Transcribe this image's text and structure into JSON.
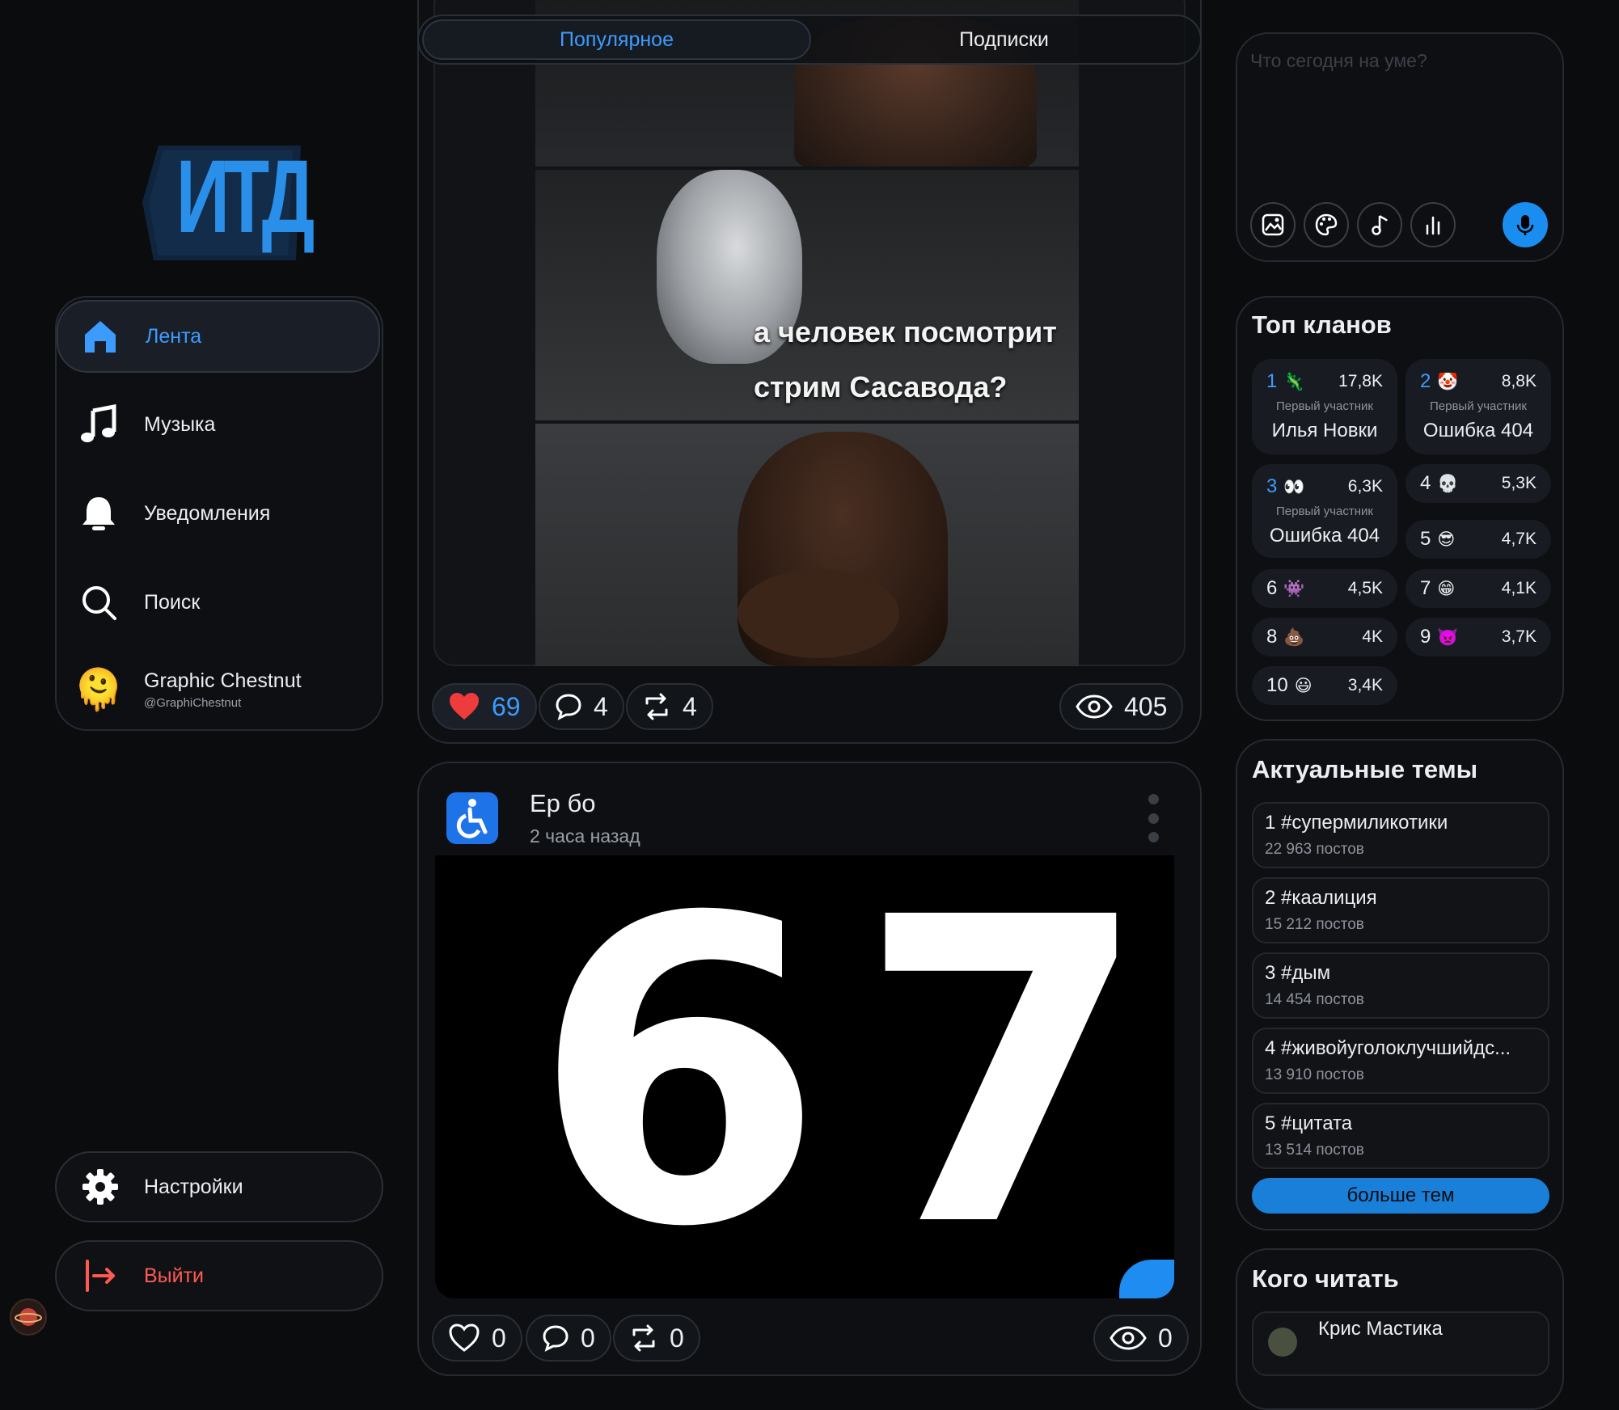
{
  "app": {
    "logo_text": "ИТД"
  },
  "nav": {
    "items": [
      {
        "label": "Лента",
        "icon": "home-icon",
        "active": true
      },
      {
        "label": "Музыка",
        "icon": "music-note-icon"
      },
      {
        "label": "Уведомления",
        "icon": "bell-icon"
      },
      {
        "label": "Поиск",
        "icon": "search-icon"
      }
    ],
    "profile": {
      "name": "Graphic Chestnut",
      "handle": "@GraphiChestnut",
      "avatar_emoji": "🫠"
    },
    "settings_label": "Настройки",
    "logout_label": "Выйти"
  },
  "feed": {
    "tabs": [
      {
        "label": "Популярное",
        "active": true
      },
      {
        "label": "Подписки"
      }
    ],
    "post1": {
      "meme_text_line1": "а человек посмотрит",
      "meme_text_line2": "стрим Сасавода?",
      "likes": "69",
      "comments": "4",
      "reposts": "4",
      "views": "405"
    },
    "post2": {
      "author": "Ер бо",
      "avatar_emoji": "♿",
      "time": "2 часа назад",
      "image_text": "67",
      "likes": "0",
      "comments": "0",
      "reposts": "0",
      "views": "0"
    }
  },
  "composer": {
    "placeholder": "Что сегодня на уме?"
  },
  "clans": {
    "title": "Топ кланов",
    "first_member_label": "Первый участник",
    "items": [
      {
        "rank": "1",
        "emoji": "🦎",
        "count": "17,8K",
        "member": "Илья Новки"
      },
      {
        "rank": "2",
        "emoji": "🤡",
        "count": "8,8K",
        "member": "Ошибка 404"
      },
      {
        "rank": "3",
        "emoji": "👀",
        "count": "6,3K",
        "member": "Ошибка 404"
      },
      {
        "rank": "4",
        "emoji": "💀",
        "count": "5,3K"
      },
      {
        "rank": "5",
        "emoji": "😎",
        "count": "4,7K"
      },
      {
        "rank": "6",
        "emoji": "👾",
        "count": "4,5K"
      },
      {
        "rank": "7",
        "emoji": "😁",
        "count": "4,1K"
      },
      {
        "rank": "8",
        "emoji": "💩",
        "count": "4K"
      },
      {
        "rank": "9",
        "emoji": "👿",
        "count": "3,7K"
      },
      {
        "rank": "10",
        "emoji": "😃",
        "count": "3,4K"
      }
    ]
  },
  "topics": {
    "title": "Актуальные темы",
    "items": [
      {
        "title": "1 #супермиликотики",
        "count": "22 963 постов"
      },
      {
        "title": "2 #каалиция",
        "count": "15 212 постов"
      },
      {
        "title": "3 #дым",
        "count": "14 454 постов"
      },
      {
        "title": "4 #живойуголоклучшийдс...",
        "count": "13 910 постов"
      },
      {
        "title": "5 #цитата",
        "count": "13 514 постов"
      }
    ],
    "more_label": "больше тем"
  },
  "follow": {
    "title": "Кого читать",
    "first_name": "Крис Мастика"
  },
  "colors": {
    "accent": "#3d9bff",
    "button_blue": "#1a7fd9",
    "danger": "#ff5a52",
    "bg": "#0b0c0e"
  }
}
